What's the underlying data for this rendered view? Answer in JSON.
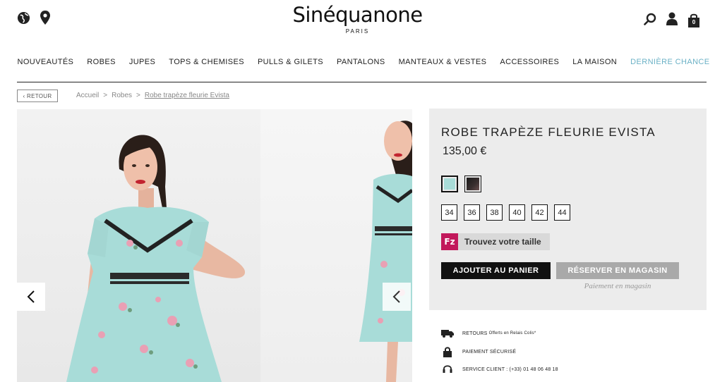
{
  "header": {
    "brand": "Sinéquanone",
    "brand_sub": "PARIS",
    "cart_count": "0",
    "icons": [
      "globe-icon",
      "location-pin-icon",
      "search-icon",
      "user-icon",
      "shopping-bag-icon"
    ]
  },
  "nav": {
    "items": [
      "NOUVEAUTÉS",
      "ROBES",
      "JUPES",
      "TOPS & CHEMISES",
      "PULLS & GILETS",
      "PANTALONS",
      "MANTEAUX & VESTES",
      "ACCESSOIRES",
      "LA MAISON",
      "DERNIÈRE CHANCE"
    ]
  },
  "breadcrumb": {
    "back": "‹ RETOUR",
    "items": [
      "Accueil",
      "Robes",
      "Robe trapèze fleurie Evista"
    ],
    "separator": ">"
  },
  "product": {
    "title": "ROBE TRAPÈZE FLEURIE EVISTA",
    "price": "135,00 €",
    "colors": [
      "#a8dcd8",
      "#2a2626"
    ],
    "sizes": [
      "34",
      "36",
      "38",
      "40",
      "42",
      "44"
    ],
    "size_finder": "Trouvez votre taille",
    "size_finder_logo": "Fz",
    "add_to_cart": "AJOUTER AU PANIER",
    "reserve": "RÉSERVER EN MAGASIN",
    "reserve_note": "Paiement en magasin"
  },
  "services": {
    "returns": "RETOURS",
    "returns_detail": "Offerts en Relais Colis*",
    "secure": "PAIEMENT SÉCURISÉ",
    "client": "SERVICE CLIENT : (+33) 01 48 06 48 18"
  },
  "colors": {
    "accent": "#6bb1c6",
    "dress": "#a8dcd8",
    "fz_brand": "#c2185b"
  }
}
